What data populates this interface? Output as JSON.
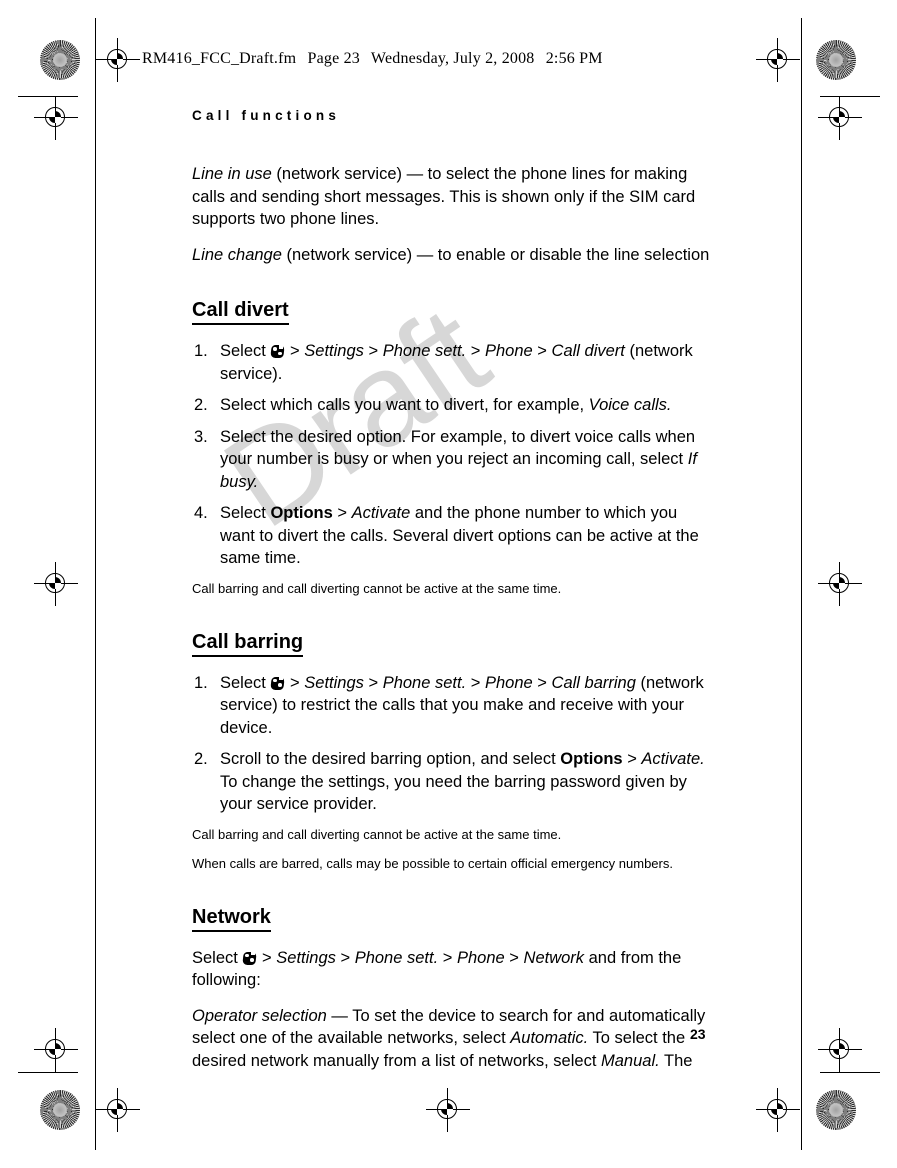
{
  "film_header": {
    "filename": "RM416_FCC_Draft.fm",
    "page_label": "Page 23",
    "date": "Wednesday, July 2, 2008",
    "time": "2:56 PM"
  },
  "watermark": {
    "text": "Draft",
    "color": "#d7d7d7"
  },
  "running_header": "Call functions",
  "page_number": "23",
  "content": {
    "line_in_use": {
      "term": "Line in use",
      "rest": " (network service) — to select the phone lines for making calls and sending short messages. This is shown only if the SIM card supports two phone lines."
    },
    "line_change": {
      "term": "Line change",
      "rest": " (network service) — to enable or disable the line selection"
    },
    "call_divert": {
      "heading": "Call divert",
      "step1": {
        "num": "1.",
        "a": "Select ",
        "icon": "nokia-menu-icon",
        "sep1": " > ",
        "settings": "Settings",
        "sep2": " > ",
        "phone_sett": "Phone sett.",
        "sep3": " > ",
        "phone": "Phone",
        "sep4": " > ",
        "target": "Call divert",
        "tail": " (network service)."
      },
      "step2": {
        "num": "2.",
        "a": "Select which calls you want to divert, for example, ",
        "italic": "Voice calls.",
        "tail": ""
      },
      "step3": {
        "num": "3.",
        "a": "Select the desired option. For example, to divert voice calls when your number is busy or when you reject an incoming call, select ",
        "italic": "If busy.",
        "tail": ""
      },
      "step4": {
        "num": "4.",
        "a": "Select ",
        "bold": "Options",
        "sep1": " > ",
        "italic": "Activate",
        "tail": " and the phone number to which you want to divert the calls. Several divert options can be active at the same time."
      },
      "note": "Call barring and call diverting cannot be active at the same time."
    },
    "call_barring": {
      "heading": "Call barring",
      "step1": {
        "num": "1.",
        "a": "Select ",
        "icon": "nokia-menu-icon",
        "sep1": " > ",
        "settings": "Settings",
        "sep2": " > ",
        "phone_sett": "Phone sett.",
        "sep3": " > ",
        "phone": "Phone",
        "sep4": " > ",
        "target": "Call barring",
        "tail": " (network service) to restrict the calls that you make and receive with your device."
      },
      "step2": {
        "num": "2.",
        "a": "Scroll to the desired barring option, and select ",
        "bold": "Options",
        "sep1": " > ",
        "italic": "Activate.",
        "tail": " To change the settings, you need the barring password given by your service provider."
      },
      "note1": "Call barring and call diverting cannot be active at the same time.",
      "note2": "When calls are barred, calls may be possible to certain official emergency numbers."
    },
    "network": {
      "heading": "Network",
      "intro": {
        "a": "Select ",
        "icon": "nokia-menu-icon",
        "sep1": " > ",
        "settings": "Settings",
        "sep2": " > ",
        "phone_sett": "Phone sett.",
        "sep3": " > ",
        "phone": "Phone",
        "sep4": " > ",
        "target": "Network",
        "tail": " and from the following:"
      },
      "operator_selection": {
        "term": "Operator selection",
        "a": " — To set the device to search for and automatically select one of the available networks, select ",
        "automatic": "Automatic.",
        "b": " To select the desired network manually from a list of networks, select ",
        "manual": "Manual.",
        "tail": " The"
      }
    }
  }
}
